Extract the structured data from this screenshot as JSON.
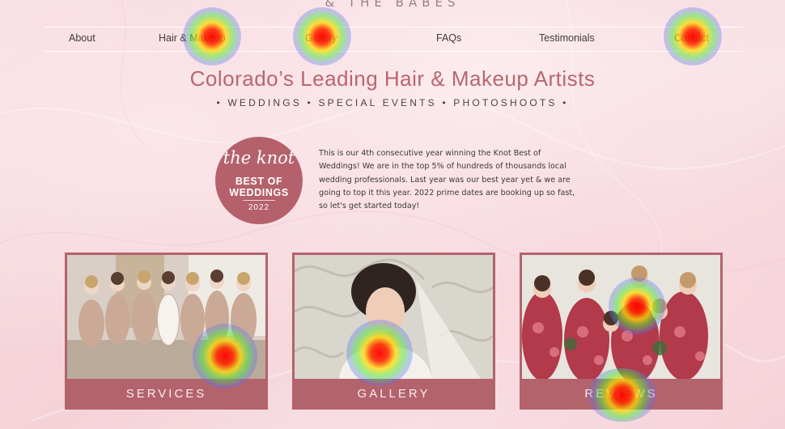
{
  "brand": "& THE BABES",
  "nav": [
    "About",
    "Hair & Makeup",
    "Gallery",
    "FAQs",
    "Testimonials",
    "Contact"
  ],
  "headline": "Colorado’s Leading Hair & Makeup Artists",
  "subline": "• WEDDINGS • SPECIAL EVENTS • PHOTOSHOOTS •",
  "badge": {
    "script": "the knot",
    "line1": "BEST OF",
    "line2": "WEDDINGS",
    "year": "2022"
  },
  "blurb": "This is our 4th consecutive year winning the Knot Best of Weddings! We are in the top 5% of hundreds of thousands local wedding professionals. Last year was our best year yet & we are going to top it this year. 2022 prime dates are booking up so fast, so let's get started today!",
  "cards": [
    {
      "label": "SERVICES"
    },
    {
      "label": "GALLERY"
    },
    {
      "label": "REVIEWS"
    }
  ],
  "colors": {
    "accent": "#b5616c",
    "headline": "#b9656f",
    "background": "#f8dde2",
    "heatmap_hot": "#ff0000"
  }
}
